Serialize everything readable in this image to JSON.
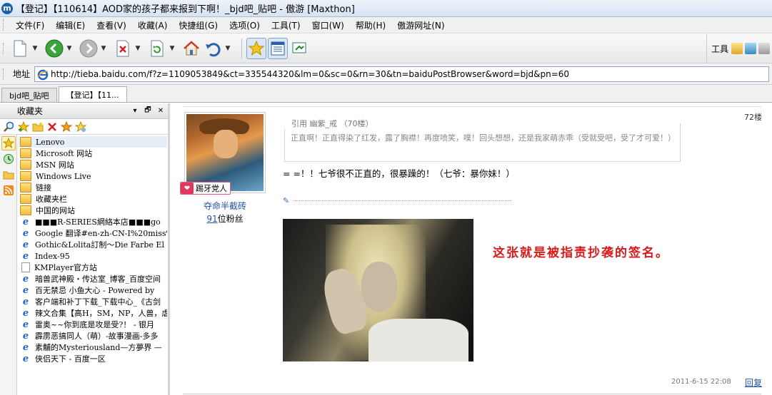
{
  "window": {
    "title": "【登记】【110614】AOD家的孩子都来报到下啊！_bjd吧_贴吧 - 傲游 [Maxthon]",
    "app_icon": "m"
  },
  "menu": [
    "文件(F)",
    "编辑(E)",
    "查看(V)",
    "收藏(A)",
    "快捷组(G)",
    "选项(O)",
    "工具(T)",
    "窗口(W)",
    "帮助(H)",
    "傲游网址(N)"
  ],
  "toolbar": {
    "tools_label": "工具",
    "icons": [
      "new-page-icon",
      "back-icon",
      "forward-icon",
      "stop-icon",
      "refresh-icon",
      "home-icon",
      "undo-icon",
      "favorites-star-icon",
      "list-icon",
      "screen-icon"
    ]
  },
  "address": {
    "label": "地址",
    "url": "http://tieba.baidu.com/f?z=1109053849&ct=335544320&lm=0&sc=0&rn=30&tn=baiduPostBrowser&word=bjd&pn=60"
  },
  "tabs": [
    {
      "label": "bjd吧_贴吧",
      "active": false
    },
    {
      "label": "【登记】【11...",
      "active": true
    }
  ],
  "sidebar": {
    "title": "收藏夹",
    "pin_label": "▾",
    "restore_label": "🗗",
    "close_label": "✕",
    "items": [
      {
        "label": "Lenovo",
        "type": "folder"
      },
      {
        "label": "Microsoft 网站",
        "type": "folder"
      },
      {
        "label": "MSN 网站",
        "type": "folder"
      },
      {
        "label": "Windows Live",
        "type": "folder"
      },
      {
        "label": "链接",
        "type": "folder"
      },
      {
        "label": "收藏夹栏",
        "type": "folder"
      },
      {
        "label": "中国的网站",
        "type": "folder"
      },
      {
        "label": "■■■R-SERIES網絡本店■■■go",
        "type": "ie"
      },
      {
        "label": "Google 翻译#en-zh-CN-I%20miss%",
        "type": "ie"
      },
      {
        "label": "Gothic&Lolita訂制～Die Farbe El",
        "type": "ie"
      },
      {
        "label": "Index-95",
        "type": "ie"
      },
      {
        "label": "KMPlayer官方站",
        "type": "page"
      },
      {
        "label": "暗兽武神殿・传达室_博客_百度空间",
        "type": "ie"
      },
      {
        "label": "百无禁忌 小鱼大心 - Powered by",
        "type": "ie"
      },
      {
        "label": "客户端和补丁下载_下载中心_《古剑",
        "type": "ie"
      },
      {
        "label": "辣文合集【高H，SM，NP，人兽，虐",
        "type": "ie"
      },
      {
        "label": "雷奥~~你到底是攻是受?！ - 银月",
        "type": "ie"
      },
      {
        "label": "霹雳恶搞同人（萌）-故事漫画-多多",
        "type": "ie"
      },
      {
        "label": "素黼的Mysteriousland—方夢界 —",
        "type": "ie"
      },
      {
        "label": "侠侣天下 - 百度一区",
        "type": "ie"
      }
    ]
  },
  "post": {
    "floor": "72楼",
    "user": "夺命半截砖",
    "badge": "踢牙党人",
    "fans_count": "91",
    "fans_suffix": "位粉丝",
    "quote_head": "引用 幽紫_戒 （70楼）",
    "quote_body": "正直啊！正直得染了红发，露了胸襟！再度喷笑，噗！回头想想，还是我家萌赤乖（受就受吧，受了才可爱！）",
    "text": "= =！！七爷很不正直的，很暴躁的！（七爷：暴你妹！）",
    "caption": "这张就是被指责抄袭的签名。",
    "date": "2011-6-15 22:08",
    "reply": "回复"
  }
}
